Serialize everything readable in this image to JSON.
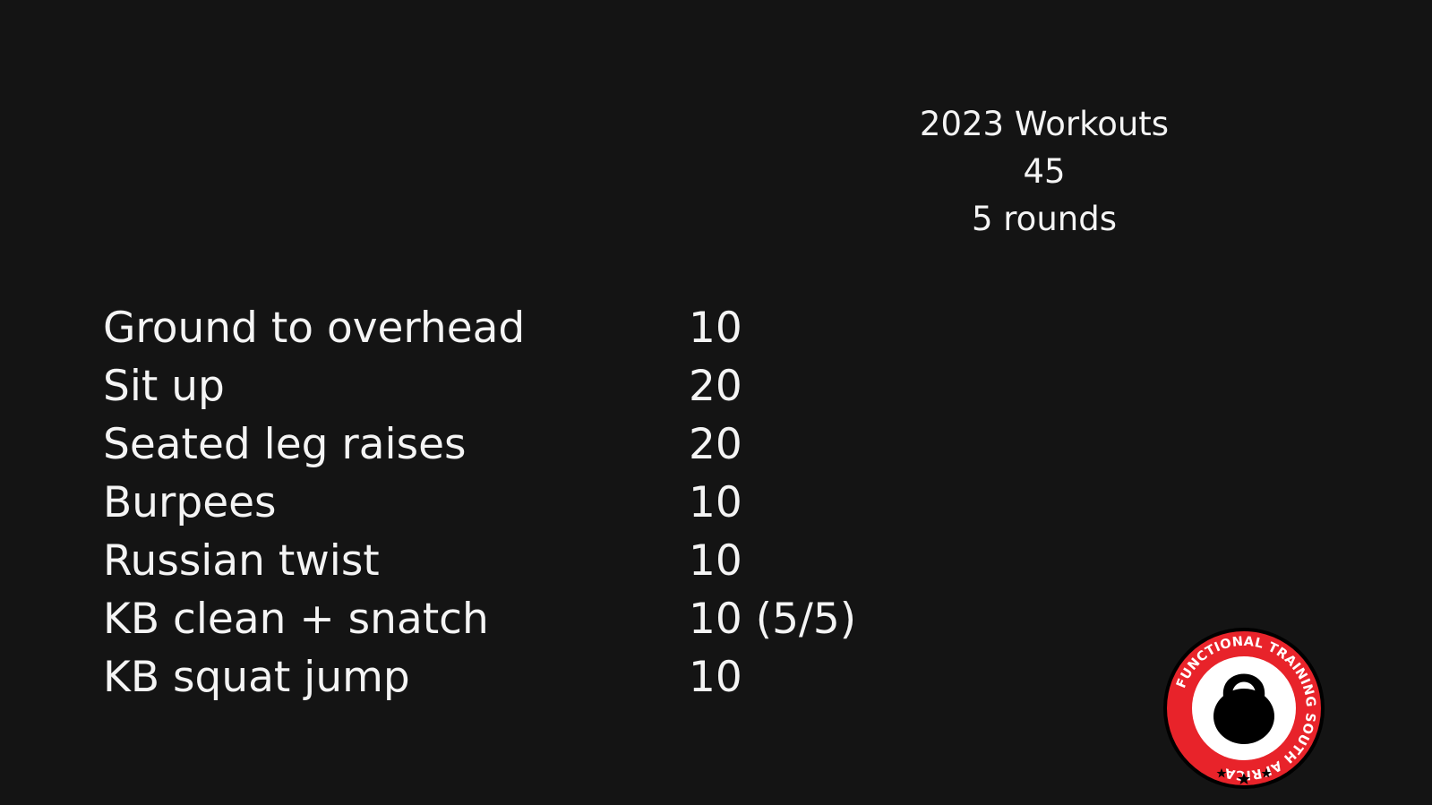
{
  "header": {
    "title": "2023 Workouts",
    "number": "45",
    "rounds": "5 rounds"
  },
  "exercises": [
    {
      "name": "Ground to overhead",
      "reps": "10"
    },
    {
      "name": "Sit up",
      "reps": "20"
    },
    {
      "name": "Seated leg raises",
      "reps": "20"
    },
    {
      "name": "Burpees",
      "reps": "10"
    },
    {
      "name": "Russian twist",
      "reps": "10"
    },
    {
      "name": "KB clean + snatch",
      "reps": "10 (5/5)"
    },
    {
      "name": "KB squat jump",
      "reps": "10"
    }
  ],
  "logo": {
    "text": "FUNCTIONAL TRAINING SOUTH AFRICA",
    "icon": "kettlebell-icon",
    "ring_color": "#e8232a",
    "inner_color": "#ffffff",
    "mark_color": "#000000"
  }
}
